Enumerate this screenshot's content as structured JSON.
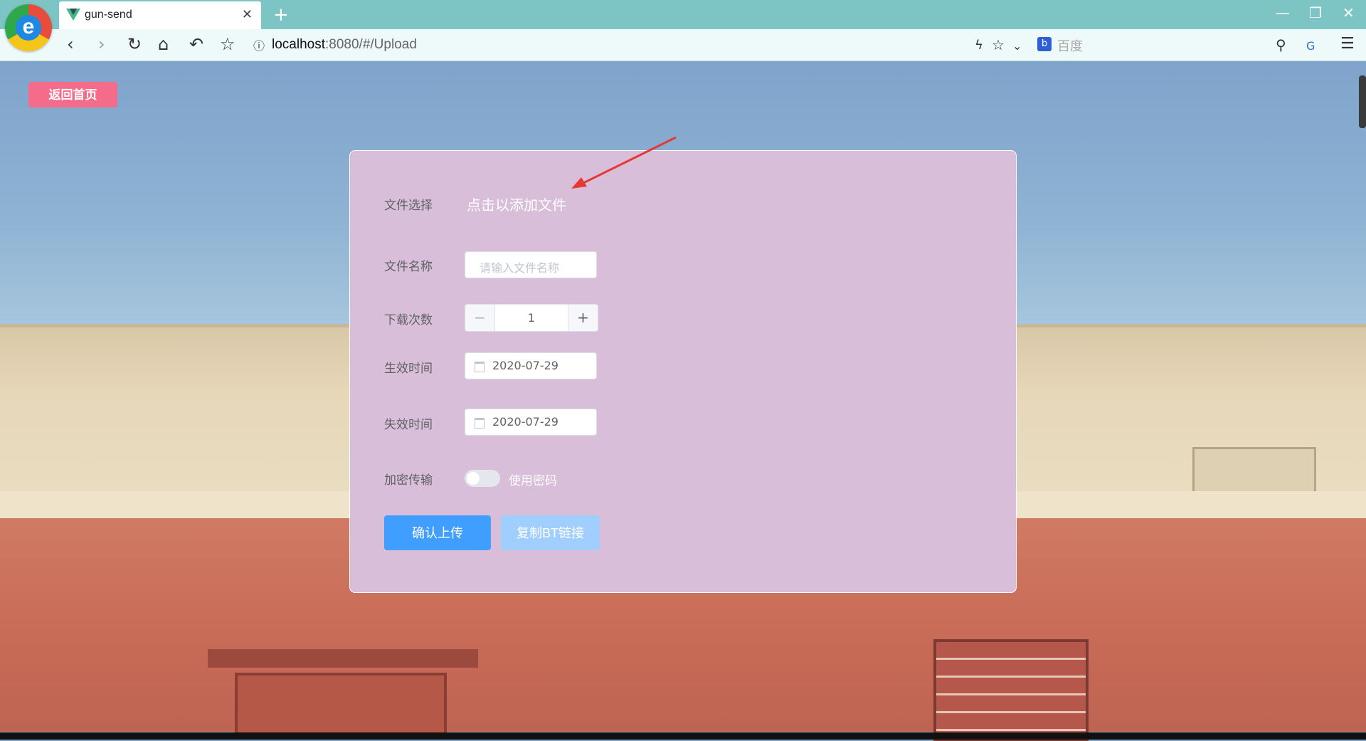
{
  "browser": {
    "tab_title": "gun-send",
    "url_host": "localhost",
    "url_path": ":8080/#/Upload",
    "search_placeholder": "百度"
  },
  "page": {
    "home_button": "返回首页",
    "form": {
      "file_select_label": "文件选择",
      "file_select_action": "点击以添加文件",
      "file_name_label": "文件名称",
      "file_name_placeholder": "请输入文件名称",
      "download_count_label": "下载次数",
      "download_count_value": "1",
      "effective_time_label": "生效时间",
      "effective_time_value": "2020-07-29",
      "expire_time_label": "失效时间",
      "expire_time_value": "2020-07-29",
      "encrypt_label": "加密传输",
      "encrypt_switch_text": "使用密码",
      "encrypt_enabled": false,
      "confirm_button": "确认上传",
      "copy_button": "复制BT链接"
    }
  },
  "colors": {
    "card_bg": "#d8bed8",
    "primary": "#409eff",
    "primary_light": "#a0cfff",
    "home_button": "#f56c8a",
    "annotation_arrow": "#e53935"
  }
}
